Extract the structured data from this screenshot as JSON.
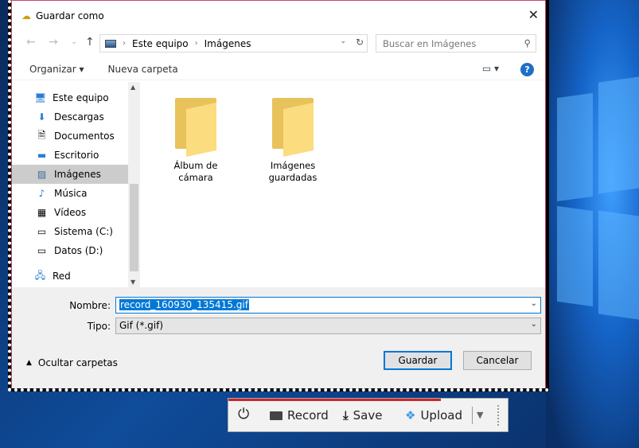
{
  "dialog": {
    "title": "Guardar como",
    "close": "✕"
  },
  "nav": {
    "back": "←",
    "forward": "→",
    "recent": "⌄",
    "up": "↑",
    "path": [
      "Este equipo",
      "Imágenes"
    ],
    "search_placeholder": "Buscar en Imágenes"
  },
  "toolbar": {
    "organize": "Organizar ▾",
    "new_folder": "Nueva carpeta",
    "help": "?"
  },
  "sidebar": {
    "items": [
      {
        "label": "Este equipo",
        "icon": "🖥"
      },
      {
        "label": "Descargas",
        "icon": "⬇"
      },
      {
        "label": "Documentos",
        "icon": "🗎"
      },
      {
        "label": "Escritorio",
        "icon": "▬"
      },
      {
        "label": "Imágenes",
        "icon": "▨"
      },
      {
        "label": "Música",
        "icon": "♪"
      },
      {
        "label": "Vídeos",
        "icon": "▦"
      },
      {
        "label": "Sistema (C:)",
        "icon": "▭"
      },
      {
        "label": "Datos (D:)",
        "icon": "▭"
      },
      {
        "label": "Red",
        "icon": "🖧"
      }
    ]
  },
  "folders": [
    {
      "line1": "Álbum de",
      "line2": "cámara"
    },
    {
      "line1": "Imágenes",
      "line2": "guardadas"
    }
  ],
  "form": {
    "name_label": "Nombre:",
    "name_value": "record_160930_135415.gif",
    "type_label": "Tipo:",
    "type_value": "Gif (*.gif)"
  },
  "buttons": {
    "save": "Guardar",
    "cancel": "Cancelar",
    "hide_folders": "Ocultar carpetas"
  },
  "recorder": {
    "record": "Record",
    "save": "Save",
    "upload": "Upload",
    "progress": 0.76,
    "accent": "#c8272d"
  }
}
